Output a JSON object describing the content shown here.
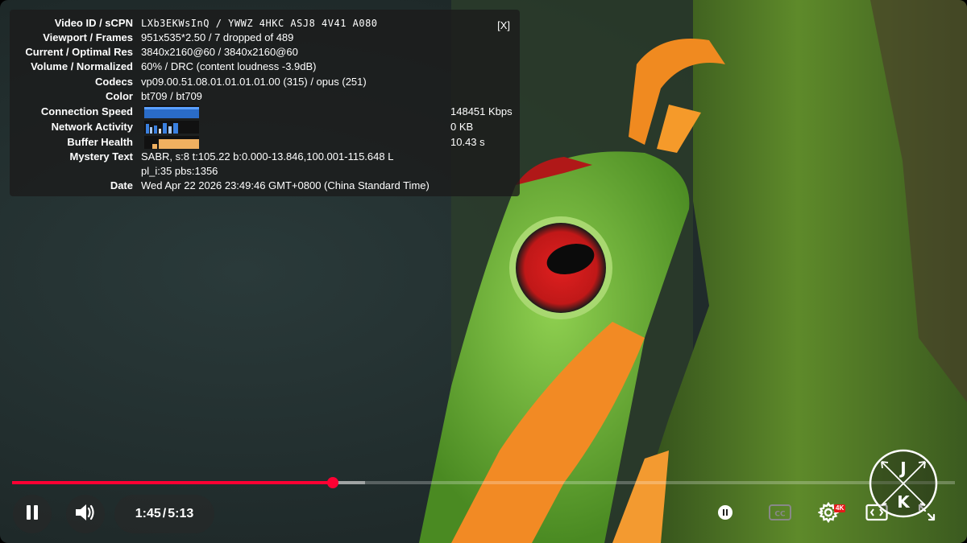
{
  "stats": {
    "close_label": "[X]",
    "rows": [
      {
        "label": "Video ID / sCPN",
        "value": "LXb3EKWsInQ  /  YWWZ 4HKC ASJ8 4V41 A080"
      },
      {
        "label": "Viewport / Frames",
        "value": "951x535*2.50 / 7 dropped of 489"
      },
      {
        "label": "Current / Optimal Res",
        "value": "3840x2160@60 / 3840x2160@60"
      },
      {
        "label": "Volume / Normalized",
        "value": "60% / DRC (content loudness -3.9dB)"
      },
      {
        "label": "Codecs",
        "value": "vp09.00.51.08.01.01.01.01.00 (315) / opus (251)"
      },
      {
        "label": "Color",
        "value": "bt709 / bt709"
      },
      {
        "label": "Connection Speed",
        "value": "148451 Kbps"
      },
      {
        "label": "Network Activity",
        "value": "0 KB"
      },
      {
        "label": "Buffer Health",
        "value": "10.43 s"
      },
      {
        "label": "Mystery Text",
        "value": "SABR, s:8 t:105.22 b:0.000-13.846,100.001-115.648 L",
        "value2": "pl_i:35 pbs:1356"
      },
      {
        "label": "Date",
        "value": "Wed Apr 22 2026 23:49:46 GMT+0800 (China Standard Time)"
      }
    ]
  },
  "player": {
    "current_time": "1:45",
    "separator": "/",
    "duration": "5:13",
    "progress_fraction": 0.34,
    "buffered_fraction": 0.374,
    "quality_badge": "4K",
    "accent_color": "#ff0033"
  },
  "logo": {
    "top_letter": "J",
    "bottom_letter": "K"
  },
  "icons": [
    "pause-icon",
    "volume-icon",
    "autoplay-toggle-icon",
    "captions-icon",
    "settings-icon",
    "theater-mode-icon",
    "fullscreen-icon"
  ]
}
